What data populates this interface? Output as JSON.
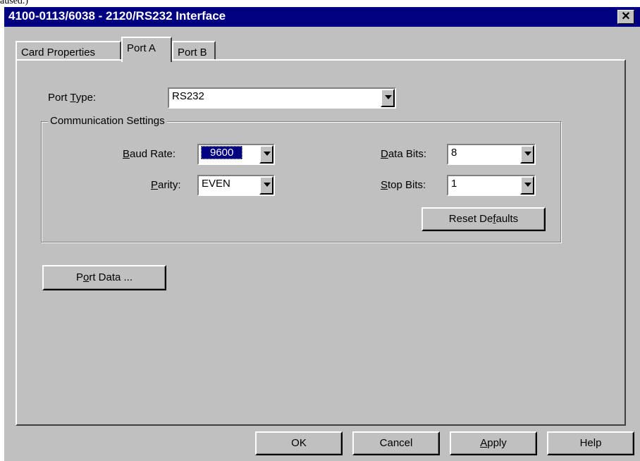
{
  "partial_text": "aused.)",
  "window": {
    "title": "4100-0113/6038 - 2120/RS232 Interface",
    "close_glyph": "✕"
  },
  "tabs": [
    {
      "label": "Card Properties",
      "active": false
    },
    {
      "label": "Port A",
      "active": true
    },
    {
      "label": "Port B",
      "active": false
    }
  ],
  "port_type": {
    "label_before": "Port ",
    "label_underline": "T",
    "label_after": "ype:",
    "value": "RS232"
  },
  "communication_settings": {
    "title": "Communication Settings",
    "baud_rate": {
      "label_underline": "B",
      "label_after": "aud Rate:",
      "value": "9600"
    },
    "parity": {
      "label_underline": "P",
      "label_after": "arity:",
      "value": "EVEN"
    },
    "data_bits": {
      "label_underline": "D",
      "label_after": "ata Bits:",
      "value": "8"
    },
    "stop_bits": {
      "label_underline": "S",
      "label_after": "top Bits:",
      "value": "1"
    },
    "reset_button": {
      "before": "Reset De",
      "underline": "f",
      "after": "aults"
    }
  },
  "port_data_button": {
    "before": "P",
    "underline": "o",
    "after": "rt Data ..."
  },
  "footer": {
    "ok": "OK",
    "cancel": "Cancel",
    "apply_underline": "A",
    "apply_after": "pply",
    "help": "Help"
  }
}
